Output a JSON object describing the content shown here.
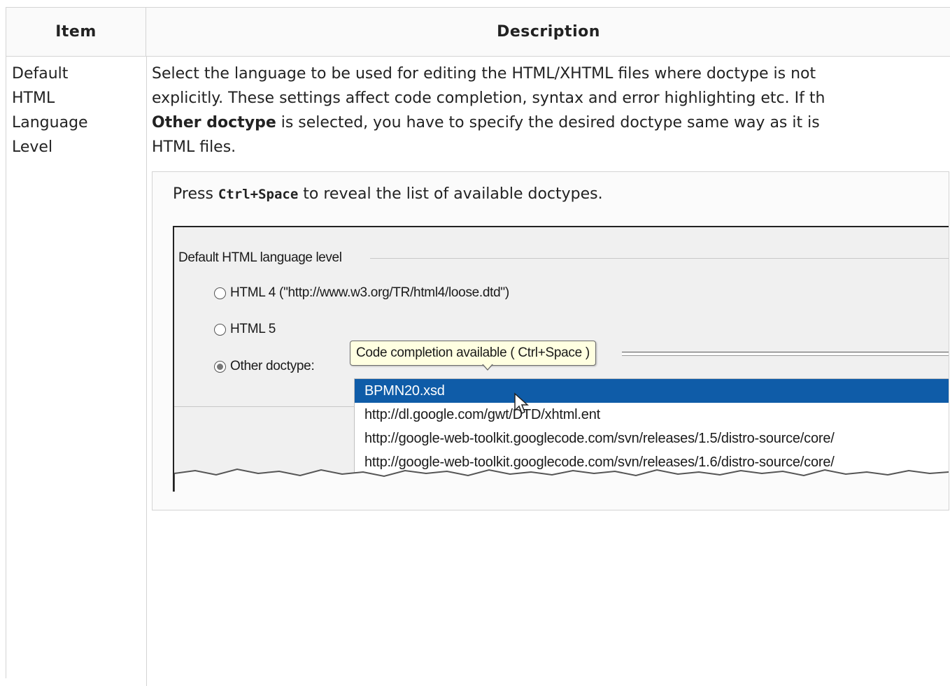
{
  "table": {
    "header_item": "Item",
    "header_description": "Description"
  },
  "row": {
    "item_lines": [
      "Default",
      "HTML",
      "Language",
      "Level"
    ],
    "description": {
      "line1": "Select the language to be used for editing the HTML/XHTML files where doctype is not",
      "line2": "explicitly. These settings affect code completion, syntax and error highlighting etc. If th",
      "line3_bold": "Other doctype",
      "line3_rest": " is selected, you have to specify the desired doctype same way as it is",
      "line4": "HTML files."
    }
  },
  "tip": {
    "prefix": "Press ",
    "shortcut": "Ctrl+Space",
    "suffix": " to reveal the list of available doctypes."
  },
  "screenshot": {
    "fieldset_legend": "Default HTML language level",
    "radio_html4": "HTML 4 (\"http://www.w3.org/TR/html4/loose.dtd\")",
    "radio_html5": "HTML 5",
    "radio_other": "Other doctype:",
    "selected_radio": "Other doctype:",
    "tooltip": "Code completion available ( Ctrl+Space )",
    "popup_items": [
      "BPMN20.xsd",
      "http://dl.google.com/gwt/DTD/xhtml.ent",
      "http://google-web-toolkit.googlecode.com/svn/releases/1.5/distro-source/core/",
      "http://google-web-toolkit.googlecode.com/svn/releases/1.6/distro-source/core/"
    ]
  },
  "colors": {
    "selection": "#0f5ca8",
    "tooltip_bg": "#ffffe1",
    "border": "#d4d4d4"
  },
  "icons": [
    "radio-icon",
    "mouse-pointer-icon"
  ]
}
